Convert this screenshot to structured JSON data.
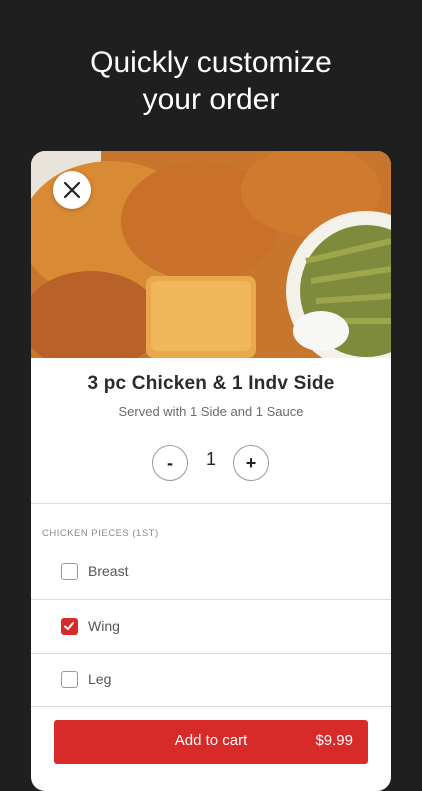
{
  "headline": {
    "line1": "Quickly customize",
    "line2": "your order"
  },
  "item": {
    "title": "3 pc Chicken & 1 Indv Side",
    "subtitle": "Served with 1 Side and 1 Sauce",
    "quantity": "1",
    "minus": "-",
    "plus": "+"
  },
  "section": {
    "label": "CHICKEN PIECES (1ST)"
  },
  "options": [
    {
      "label": "Breast",
      "checked": false
    },
    {
      "label": "Wing",
      "checked": true
    },
    {
      "label": "Leg",
      "checked": false
    }
  ],
  "cart": {
    "label": "Add to cart",
    "price": "$9.99"
  },
  "colors": {
    "accent": "#d92a2a",
    "background": "#1f1f1f"
  }
}
